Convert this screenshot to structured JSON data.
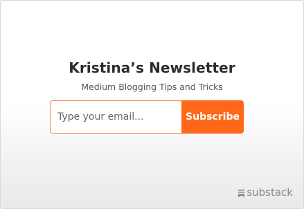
{
  "newsletter": {
    "title": "Kristina’s Newsletter",
    "subtitle": "Medium Blogging Tips and Tricks"
  },
  "form": {
    "email_placeholder": "Type your email...",
    "email_value": "",
    "subscribe_label": "Subscribe"
  },
  "brand": {
    "name": "substack",
    "icon": "substack-logo-icon"
  },
  "colors": {
    "accent": "#ff6719",
    "title": "#2b2b2b",
    "subtitle": "#555555",
    "brand": "#8a8a8a"
  }
}
